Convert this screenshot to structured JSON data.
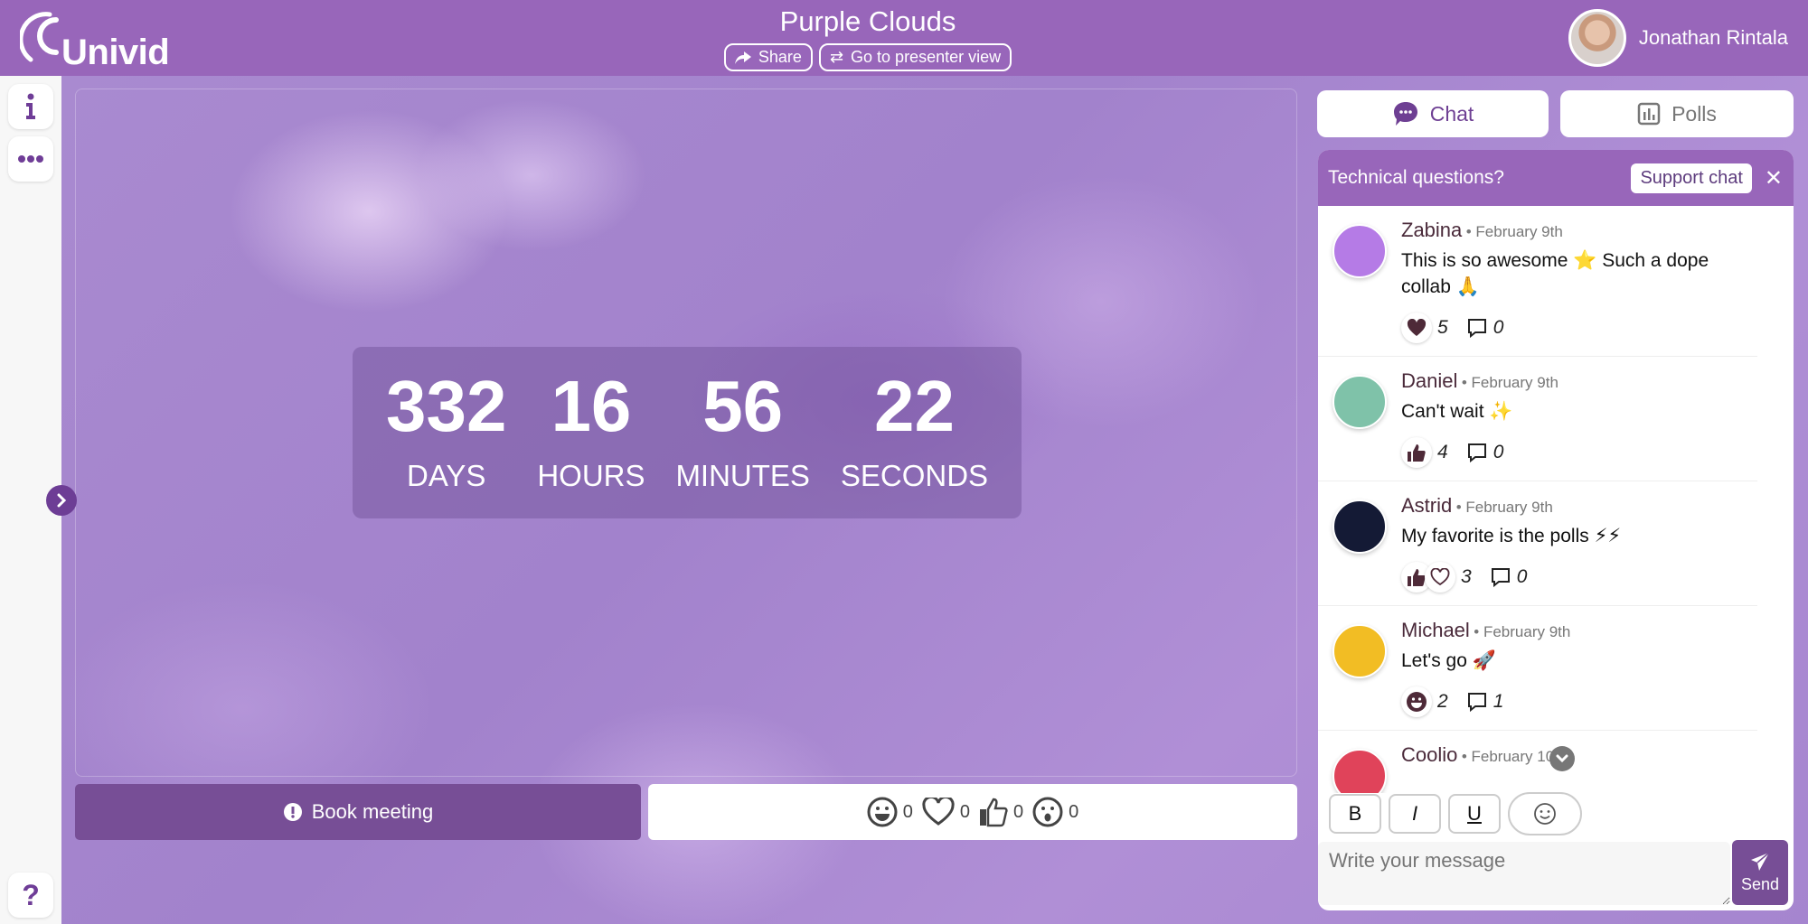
{
  "header": {
    "logo_text": "Univid",
    "event_title": "Purple Clouds",
    "share_label": "Share",
    "presenter_label": "Go to presenter view",
    "user_name": "Jonathan Rintala"
  },
  "rail": {
    "info_icon": "info-icon",
    "more_icon": "more-icon",
    "help_icon": "help-icon"
  },
  "countdown": {
    "days": "332",
    "hours": "16",
    "minutes": "56",
    "seconds": "22",
    "days_label": "DAYS",
    "hours_label": "HOURS",
    "minutes_label": "MINUTES",
    "seconds_label": "SECONDS"
  },
  "stage": {
    "book_label": "Book meeting",
    "reactions": [
      {
        "icon": "laugh-icon",
        "count": "0"
      },
      {
        "icon": "heart-icon",
        "count": "0"
      },
      {
        "icon": "thumbs-up-icon",
        "count": "0"
      },
      {
        "icon": "surprised-icon",
        "count": "0"
      }
    ]
  },
  "tabs": {
    "chat_label": "Chat",
    "polls_label": "Polls"
  },
  "support": {
    "text": "Technical questions?",
    "button_label": "Support chat"
  },
  "messages": [
    {
      "name": "Zabina",
      "date": "February 9th",
      "text": "This is so awesome ⭐ Such a dope collab 🙏",
      "reaction_count": "5",
      "reply_count": "0",
      "avatar_color": "#b57be6"
    },
    {
      "name": "Daniel",
      "date": "February 9th",
      "text": "Can't wait ✨",
      "reaction_count": "4",
      "reply_count": "0",
      "avatar_color": "#7fc2a9"
    },
    {
      "name": "Astrid",
      "date": "February 9th",
      "text": "My favorite is the polls ⚡⚡",
      "reaction_count": "3",
      "reply_count": "0",
      "avatar_color": "#141a35"
    },
    {
      "name": "Michael",
      "date": "February 9th",
      "text": "Let's go 🚀",
      "reaction_count": "2",
      "reply_count": "1",
      "avatar_color": "#f2bd24"
    },
    {
      "name": "Coolio",
      "date": "February 10th",
      "text": "",
      "reaction_count": "",
      "reply_count": "",
      "avatar_color": "#e0435a"
    }
  ],
  "composer": {
    "bold": "B",
    "italic": "I",
    "underline": "U",
    "placeholder": "Write your message",
    "send_label": "Send"
  },
  "colors": {
    "brand": "#9866ba",
    "accent_dark": "#774e96"
  }
}
